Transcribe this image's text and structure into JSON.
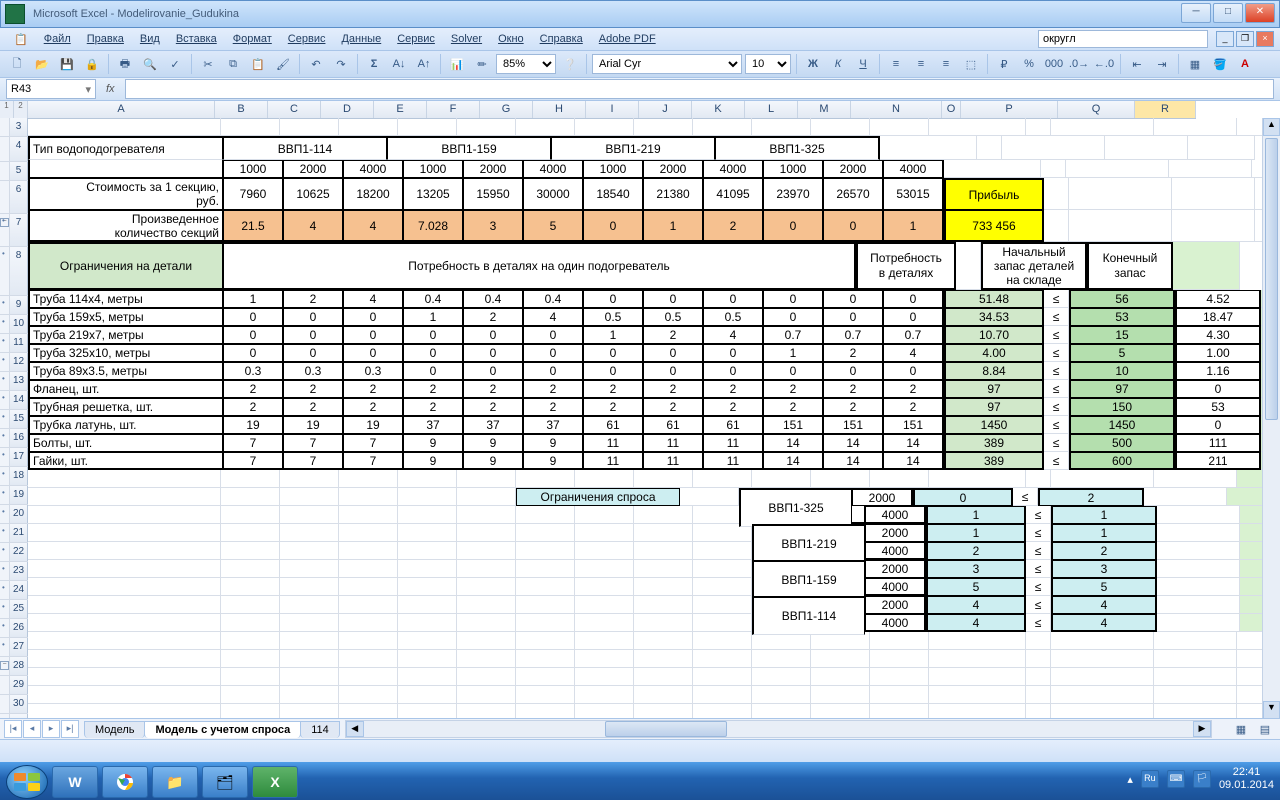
{
  "app": {
    "title": "Microsoft Excel - Modelirovanie_Gudukina"
  },
  "menu": [
    "Файл",
    "Правка",
    "Вид",
    "Вставка",
    "Формат",
    "Сервис",
    "Данные",
    "Сервис",
    "Solver",
    "Окно",
    "Справка",
    "Adobe PDF"
  ],
  "help_search": "округл",
  "font": {
    "name": "Arial Cyr",
    "size": "10"
  },
  "zoom": "85%",
  "namebox": "R43",
  "columns": [
    "A",
    "B",
    "C",
    "D",
    "E",
    "F",
    "G",
    "H",
    "I",
    "J",
    "K",
    "L",
    "M",
    "N",
    "O",
    "P",
    "Q",
    "R"
  ],
  "rowstart": 3,
  "rowend": 31,
  "tabs": [
    "Модель",
    "Модель с учетом спроса",
    "114"
  ],
  "active_tab": 1,
  "status_date": "09.01.2014",
  "status_time": "22:41",
  "lang": "Ru",
  "hdr": {
    "type_label": "Тип водоподогревателя",
    "groups": [
      "ВВП1-114",
      "ВВП1-159",
      "ВВП1-219",
      "ВВП1-325"
    ],
    "sizes": [
      "1000",
      "2000",
      "4000"
    ],
    "cost_label": "Стоимость за 1 секцию, руб.",
    "prod_label": "Произведенное количество секций",
    "profit_label": "Прибыль",
    "profit_value": "733 456",
    "costs": [
      "7960",
      "10625",
      "18200",
      "13205",
      "15950",
      "30000",
      "18540",
      "21380",
      "41095",
      "23970",
      "26570",
      "53015"
    ],
    "produced": [
      "21.5",
      "4",
      "4",
      "7.028",
      "3",
      "5",
      "0",
      "1",
      "2",
      "0",
      "0",
      "1"
    ]
  },
  "parts": {
    "constraint_label": "Ограничения на детали",
    "need_label": "Потребность в деталях на один подогреватель",
    "need_total": "Потребность в деталях",
    "stock_start": "Начальный запас деталей на складе",
    "stock_end": "Конечный запас",
    "op": "≤",
    "rows": [
      {
        "n": "Труба 114х4, метры",
        "v": [
          "1",
          "2",
          "4",
          "0.4",
          "0.4",
          "0.4",
          "0",
          "0",
          "0",
          "0",
          "0",
          "0"
        ],
        "t": "51.48",
        "s": "56",
        "e": "4.52"
      },
      {
        "n": "Труба 159х5, метры",
        "v": [
          "0",
          "0",
          "0",
          "1",
          "2",
          "4",
          "0.5",
          "0.5",
          "0.5",
          "0",
          "0",
          "0"
        ],
        "t": "34.53",
        "s": "53",
        "e": "18.47"
      },
      {
        "n": "Труба 219х7, метры",
        "v": [
          "0",
          "0",
          "0",
          "0",
          "0",
          "0",
          "1",
          "2",
          "4",
          "0.7",
          "0.7",
          "0.7"
        ],
        "t": "10.70",
        "s": "15",
        "e": "4.30"
      },
      {
        "n": "Труба 325х10, метры",
        "v": [
          "0",
          "0",
          "0",
          "0",
          "0",
          "0",
          "0",
          "0",
          "0",
          "1",
          "2",
          "4"
        ],
        "t": "4.00",
        "s": "5",
        "e": "1.00"
      },
      {
        "n": "Труба 89х3.5, метры",
        "v": [
          "0.3",
          "0.3",
          "0.3",
          "0",
          "0",
          "0",
          "0",
          "0",
          "0",
          "0",
          "0",
          "0"
        ],
        "t": "8.84",
        "s": "10",
        "e": "1.16"
      },
      {
        "n": "Фланец, шт.",
        "v": [
          "2",
          "2",
          "2",
          "2",
          "2",
          "2",
          "2",
          "2",
          "2",
          "2",
          "2",
          "2"
        ],
        "t": "97",
        "s": "97",
        "e": "0"
      },
      {
        "n": "Трубная решетка, шт.",
        "v": [
          "2",
          "2",
          "2",
          "2",
          "2",
          "2",
          "2",
          "2",
          "2",
          "2",
          "2",
          "2"
        ],
        "t": "97",
        "s": "150",
        "e": "53"
      },
      {
        "n": "Трубка латунь, шт.",
        "v": [
          "19",
          "19",
          "19",
          "37",
          "37",
          "37",
          "61",
          "61",
          "61",
          "151",
          "151",
          "151"
        ],
        "t": "1450",
        "s": "1450",
        "e": "0"
      },
      {
        "n": "Болты, шт.",
        "v": [
          "7",
          "7",
          "7",
          "9",
          "9",
          "9",
          "11",
          "11",
          "11",
          "14",
          "14",
          "14"
        ],
        "t": "389",
        "s": "500",
        "e": "111"
      },
      {
        "n": "Гайки, шт.",
        "v": [
          "7",
          "7",
          "7",
          "9",
          "9",
          "9",
          "11",
          "11",
          "11",
          "14",
          "14",
          "14"
        ],
        "t": "389",
        "s": "600",
        "e": "211"
      }
    ]
  },
  "demand": {
    "label": "Ограничения спроса",
    "rows": [
      {
        "model": "ВВП1-325",
        "l": "2000",
        "a": "0",
        "b": "2"
      },
      {
        "model": "",
        "l": "4000",
        "a": "1",
        "b": "1"
      },
      {
        "model": "ВВП1-219",
        "l": "2000",
        "a": "1",
        "b": "1"
      },
      {
        "model": "",
        "l": "4000",
        "a": "2",
        "b": "2"
      },
      {
        "model": "ВВП1-159",
        "l": "2000",
        "a": "3",
        "b": "3"
      },
      {
        "model": "",
        "l": "4000",
        "a": "5",
        "b": "5"
      },
      {
        "model": "ВВП1-114",
        "l": "2000",
        "a": "4",
        "b": "4"
      },
      {
        "model": "",
        "l": "4000",
        "a": "4",
        "b": "4"
      }
    ]
  },
  "colw": {
    "A": 186,
    "B": 52,
    "C": 52,
    "D": 52,
    "E": 52,
    "F": 52,
    "G": 52,
    "H": 52,
    "I": 52,
    "J": 52,
    "K": 52,
    "L": 52,
    "M": 52,
    "N": 90,
    "O": 18,
    "P": 96,
    "Q": 76,
    "R": 60
  }
}
